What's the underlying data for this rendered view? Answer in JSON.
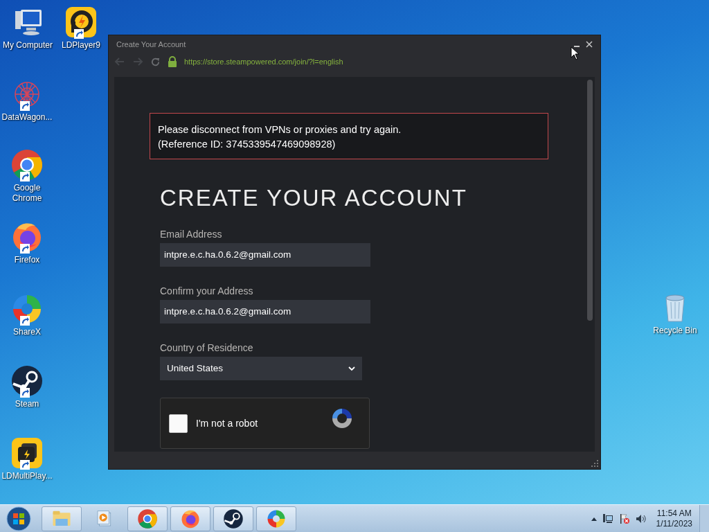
{
  "desktop_icons": [
    {
      "label": "My Computer",
      "kind": "computer",
      "shortcut": false
    },
    {
      "label": "LDPlayer9",
      "kind": "ldplayer",
      "shortcut": true
    },
    {
      "label": "DataWagon...",
      "kind": "datawagon",
      "shortcut": true
    },
    {
      "label": "Google Chrome",
      "kind": "chrome",
      "shortcut": true
    },
    {
      "label": "Firefox",
      "kind": "firefox",
      "shortcut": true
    },
    {
      "label": "ShareX",
      "kind": "sharex",
      "shortcut": true
    },
    {
      "label": "Steam",
      "kind": "steam",
      "shortcut": true
    },
    {
      "label": "LDMultiPlay...",
      "kind": "ldmulti",
      "shortcut": true
    },
    {
      "label": "Recycle Bin",
      "kind": "recycle",
      "shortcut": false
    }
  ],
  "window": {
    "title": "Create Your Account",
    "url": "https://store.steampowered.com/join/?l=english",
    "error": [
      "Please disconnect from VPNs or proxies and try again.",
      "(Reference ID: 3745339547469098928)"
    ],
    "heading": "CREATE YOUR ACCOUNT",
    "fields": [
      {
        "label": "Email Address",
        "value": "intpre.e.c.ha.0.6.2@gmail.com",
        "kind": "text"
      },
      {
        "label": "Confirm your Address",
        "value": "intpre.e.c.ha.0.6.2@gmail.com",
        "kind": "text"
      },
      {
        "label": "Country of Residence",
        "value": "United States",
        "kind": "select"
      }
    ],
    "captcha": {
      "label": "I'm not a robot",
      "checked": false
    }
  },
  "taskbar": {
    "items": [
      {
        "kind": "explorer",
        "running": true
      },
      {
        "kind": "media",
        "running": false
      },
      {
        "kind": "chrome",
        "running": true
      },
      {
        "kind": "firefox",
        "running": true
      },
      {
        "kind": "steam",
        "running": true
      },
      {
        "kind": "sharex",
        "running": true
      }
    ],
    "time": "11:54 AM",
    "date": "1/11/2023"
  }
}
